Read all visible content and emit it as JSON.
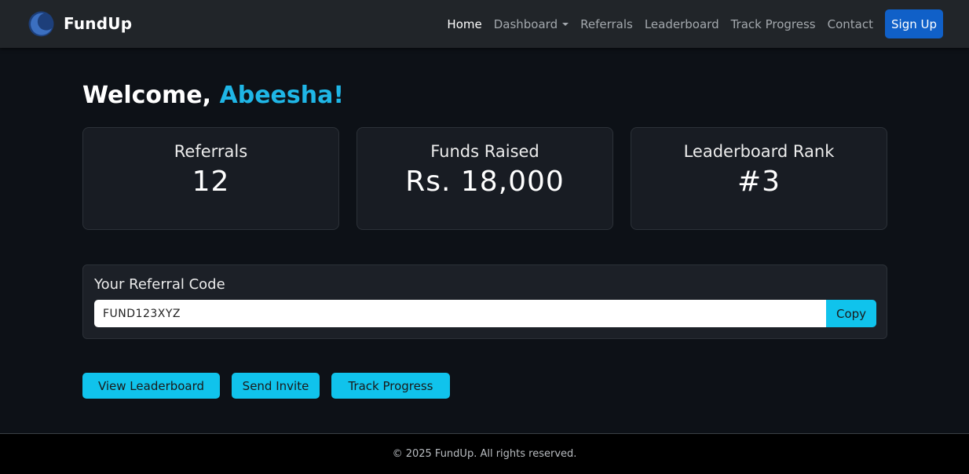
{
  "brand": {
    "name": "FundUp",
    "logo_icon": "crescent-logo-icon",
    "colors": {
      "logo_dark": "#1d3f7a",
      "logo_light": "#3b6fc0"
    }
  },
  "nav": {
    "items": [
      {
        "label": "Home",
        "active": true
      },
      {
        "label": "Dashboard",
        "dropdown": true
      },
      {
        "label": "Referrals"
      },
      {
        "label": "Leaderboard"
      },
      {
        "label": "Track Progress"
      },
      {
        "label": "Contact"
      }
    ],
    "signup_label": "Sign Up"
  },
  "welcome": {
    "prefix": "Welcome, ",
    "name": "Abeesha!"
  },
  "stats": [
    {
      "title": "Referrals",
      "value": "12"
    },
    {
      "title": "Funds Raised",
      "value": "Rs. 18,000"
    },
    {
      "title": "Leaderboard Rank",
      "value": "#3"
    }
  ],
  "referral": {
    "label": "Your Referral Code",
    "code": "FUND123XYZ",
    "copy_label": "Copy"
  },
  "actions": [
    {
      "label": "View Leaderboard"
    },
    {
      "label": "Send Invite"
    },
    {
      "label": "Track Progress"
    }
  ],
  "footer": {
    "text": "© 2025 FundUp. All rights reserved."
  },
  "colors": {
    "accent": "#10c3ec",
    "name_highlight": "#1fb6e6",
    "primary_button": "#1060c8",
    "background": "#0d1117",
    "navbar": "#212529"
  }
}
